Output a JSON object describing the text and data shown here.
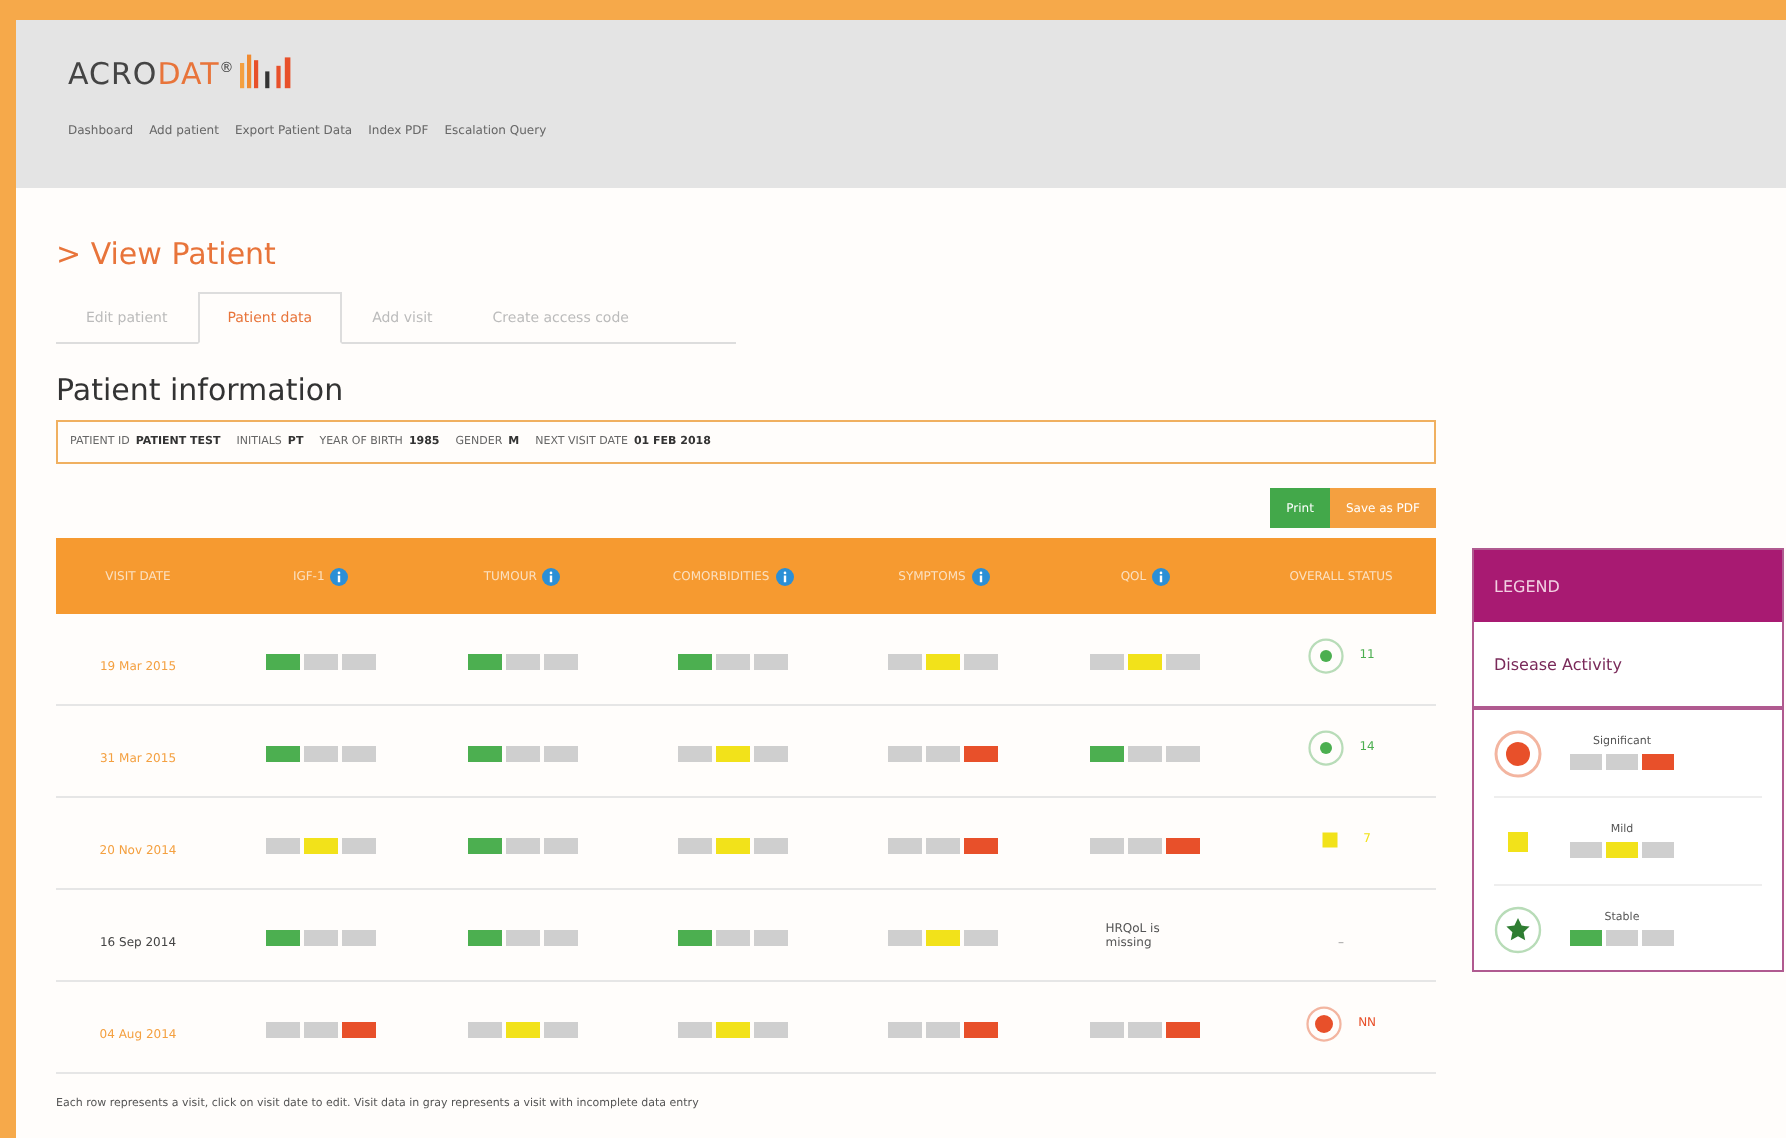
{
  "logo": {
    "text": "ACRO",
    "accent": "DAT",
    "mark": "®"
  },
  "nav": [
    "Dashboard",
    "Add patient",
    "Export Patient Data",
    "Index PDF",
    "Escalation Query"
  ],
  "page_title": "> View Patient",
  "tabs": [
    {
      "label": "Edit patient",
      "selected": false
    },
    {
      "label": "Patient data",
      "selected": true
    },
    {
      "label": "Add visit",
      "selected": false
    },
    {
      "label": "Create access code",
      "selected": false
    }
  ],
  "section_title": "Patient information",
  "patient_info": [
    {
      "label": "PATIENT ID",
      "value": "PATIENT TEST"
    },
    {
      "label": "INITIALS",
      "value": "PT"
    },
    {
      "label": "YEAR OF BIRTH",
      "value": "1985"
    },
    {
      "label": "GENDER",
      "value": "M"
    },
    {
      "label": "NEXT VISIT DATE",
      "value": "01 FEB 2018"
    }
  ],
  "buttons": [
    {
      "label": "Print",
      "kind": "primary"
    },
    {
      "label": "Save as PDF",
      "kind": "secondary"
    }
  ],
  "table": {
    "columns": [
      {
        "label": "VISIT DATE",
        "info": false
      },
      {
        "label": "IGF-1",
        "info": true
      },
      {
        "label": "TUMOUR",
        "info": true
      },
      {
        "label": "COMORBIDITIES",
        "info": true
      },
      {
        "label": "SYMPTOMS",
        "info": true
      },
      {
        "label": "QOL",
        "info": true
      },
      {
        "label": "OVERALL STATUS",
        "info": false
      }
    ],
    "rows": [
      {
        "cells": [
          {
            "kind": "date",
            "text": "19 Mar 2015",
            "incomplete": false
          },
          {
            "kind": "stable"
          },
          {
            "kind": "stable"
          },
          {
            "kind": "stable"
          },
          {
            "kind": "mild"
          },
          {
            "kind": "mild"
          },
          {
            "kind": "stable-score",
            "text": "11"
          }
        ]
      },
      {
        "cells": [
          {
            "kind": "date",
            "text": "31 Mar 2015",
            "incomplete": false
          },
          {
            "kind": "stable"
          },
          {
            "kind": "stable"
          },
          {
            "kind": "mild"
          },
          {
            "kind": "significant"
          },
          {
            "kind": "stable"
          },
          {
            "kind": "stable-score",
            "text": "14"
          }
        ]
      },
      {
        "cells": [
          {
            "kind": "date",
            "text": "20 Nov 2014",
            "incomplete": false
          },
          {
            "kind": "mild"
          },
          {
            "kind": "stable"
          },
          {
            "kind": "mild"
          },
          {
            "kind": "significant"
          },
          {
            "kind": "significant"
          },
          {
            "kind": "mild-score",
            "text": "7"
          }
        ]
      },
      {
        "cells": [
          {
            "kind": "date",
            "text": "16 Sep 2014",
            "incomplete": true
          },
          {
            "kind": "stable"
          },
          {
            "kind": "stable"
          },
          {
            "kind": "stable"
          },
          {
            "kind": "mild"
          },
          {
            "kind": "note",
            "text": "HRQoL is missing"
          },
          {
            "kind": "empty-score",
            "text": "–"
          }
        ]
      },
      {
        "cells": [
          {
            "kind": "date",
            "text": "04 Aug 2014",
            "incomplete": false
          },
          {
            "kind": "significant"
          },
          {
            "kind": "mild"
          },
          {
            "kind": "mild"
          },
          {
            "kind": "significant"
          },
          {
            "kind": "significant"
          },
          {
            "kind": "significant-score",
            "text": "NN"
          }
        ]
      }
    ]
  },
  "footnote": "Each row represents a visit, click on visit date to edit. Visit data in gray represents a visit with incomplete data entry",
  "legend": {
    "title": "LEGEND",
    "subtitle": "Disease Activity",
    "items": [
      {
        "label": "Significant",
        "kind": "significant"
      },
      {
        "label": "Mild",
        "kind": "mild"
      },
      {
        "label": "Stable",
        "kind": "stable"
      }
    ]
  }
}
